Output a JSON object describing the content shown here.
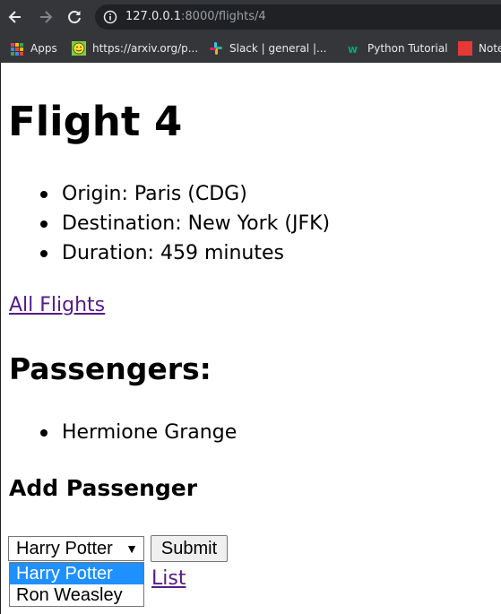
{
  "browser": {
    "url_host": "127.0.0.1",
    "url_rest": ":8000/flights/4",
    "bookmarks": [
      {
        "label": "Apps"
      },
      {
        "label": "https://arxiv.org/p..."
      },
      {
        "label": "Slack | general |..."
      },
      {
        "label": "Python Tutorial"
      },
      {
        "label": "Note"
      }
    ]
  },
  "page": {
    "title": "Flight 4",
    "details": [
      "Origin: Paris (CDG)",
      "Destination: New York (JFK)",
      "Duration: 459 minutes"
    ],
    "all_flights_link": "All Flights",
    "passengers_heading": "Passengers:",
    "passengers": [
      "Hermione Grange"
    ],
    "add_heading": "Add Passenger",
    "select_value": "Harry Potter",
    "submit_label": "Submit",
    "options": [
      "Harry Potter",
      "Ron Weasley"
    ],
    "hidden_link_text": "List"
  },
  "colors": {
    "link": "#551a8b",
    "selected_option": "#1e90ff"
  }
}
